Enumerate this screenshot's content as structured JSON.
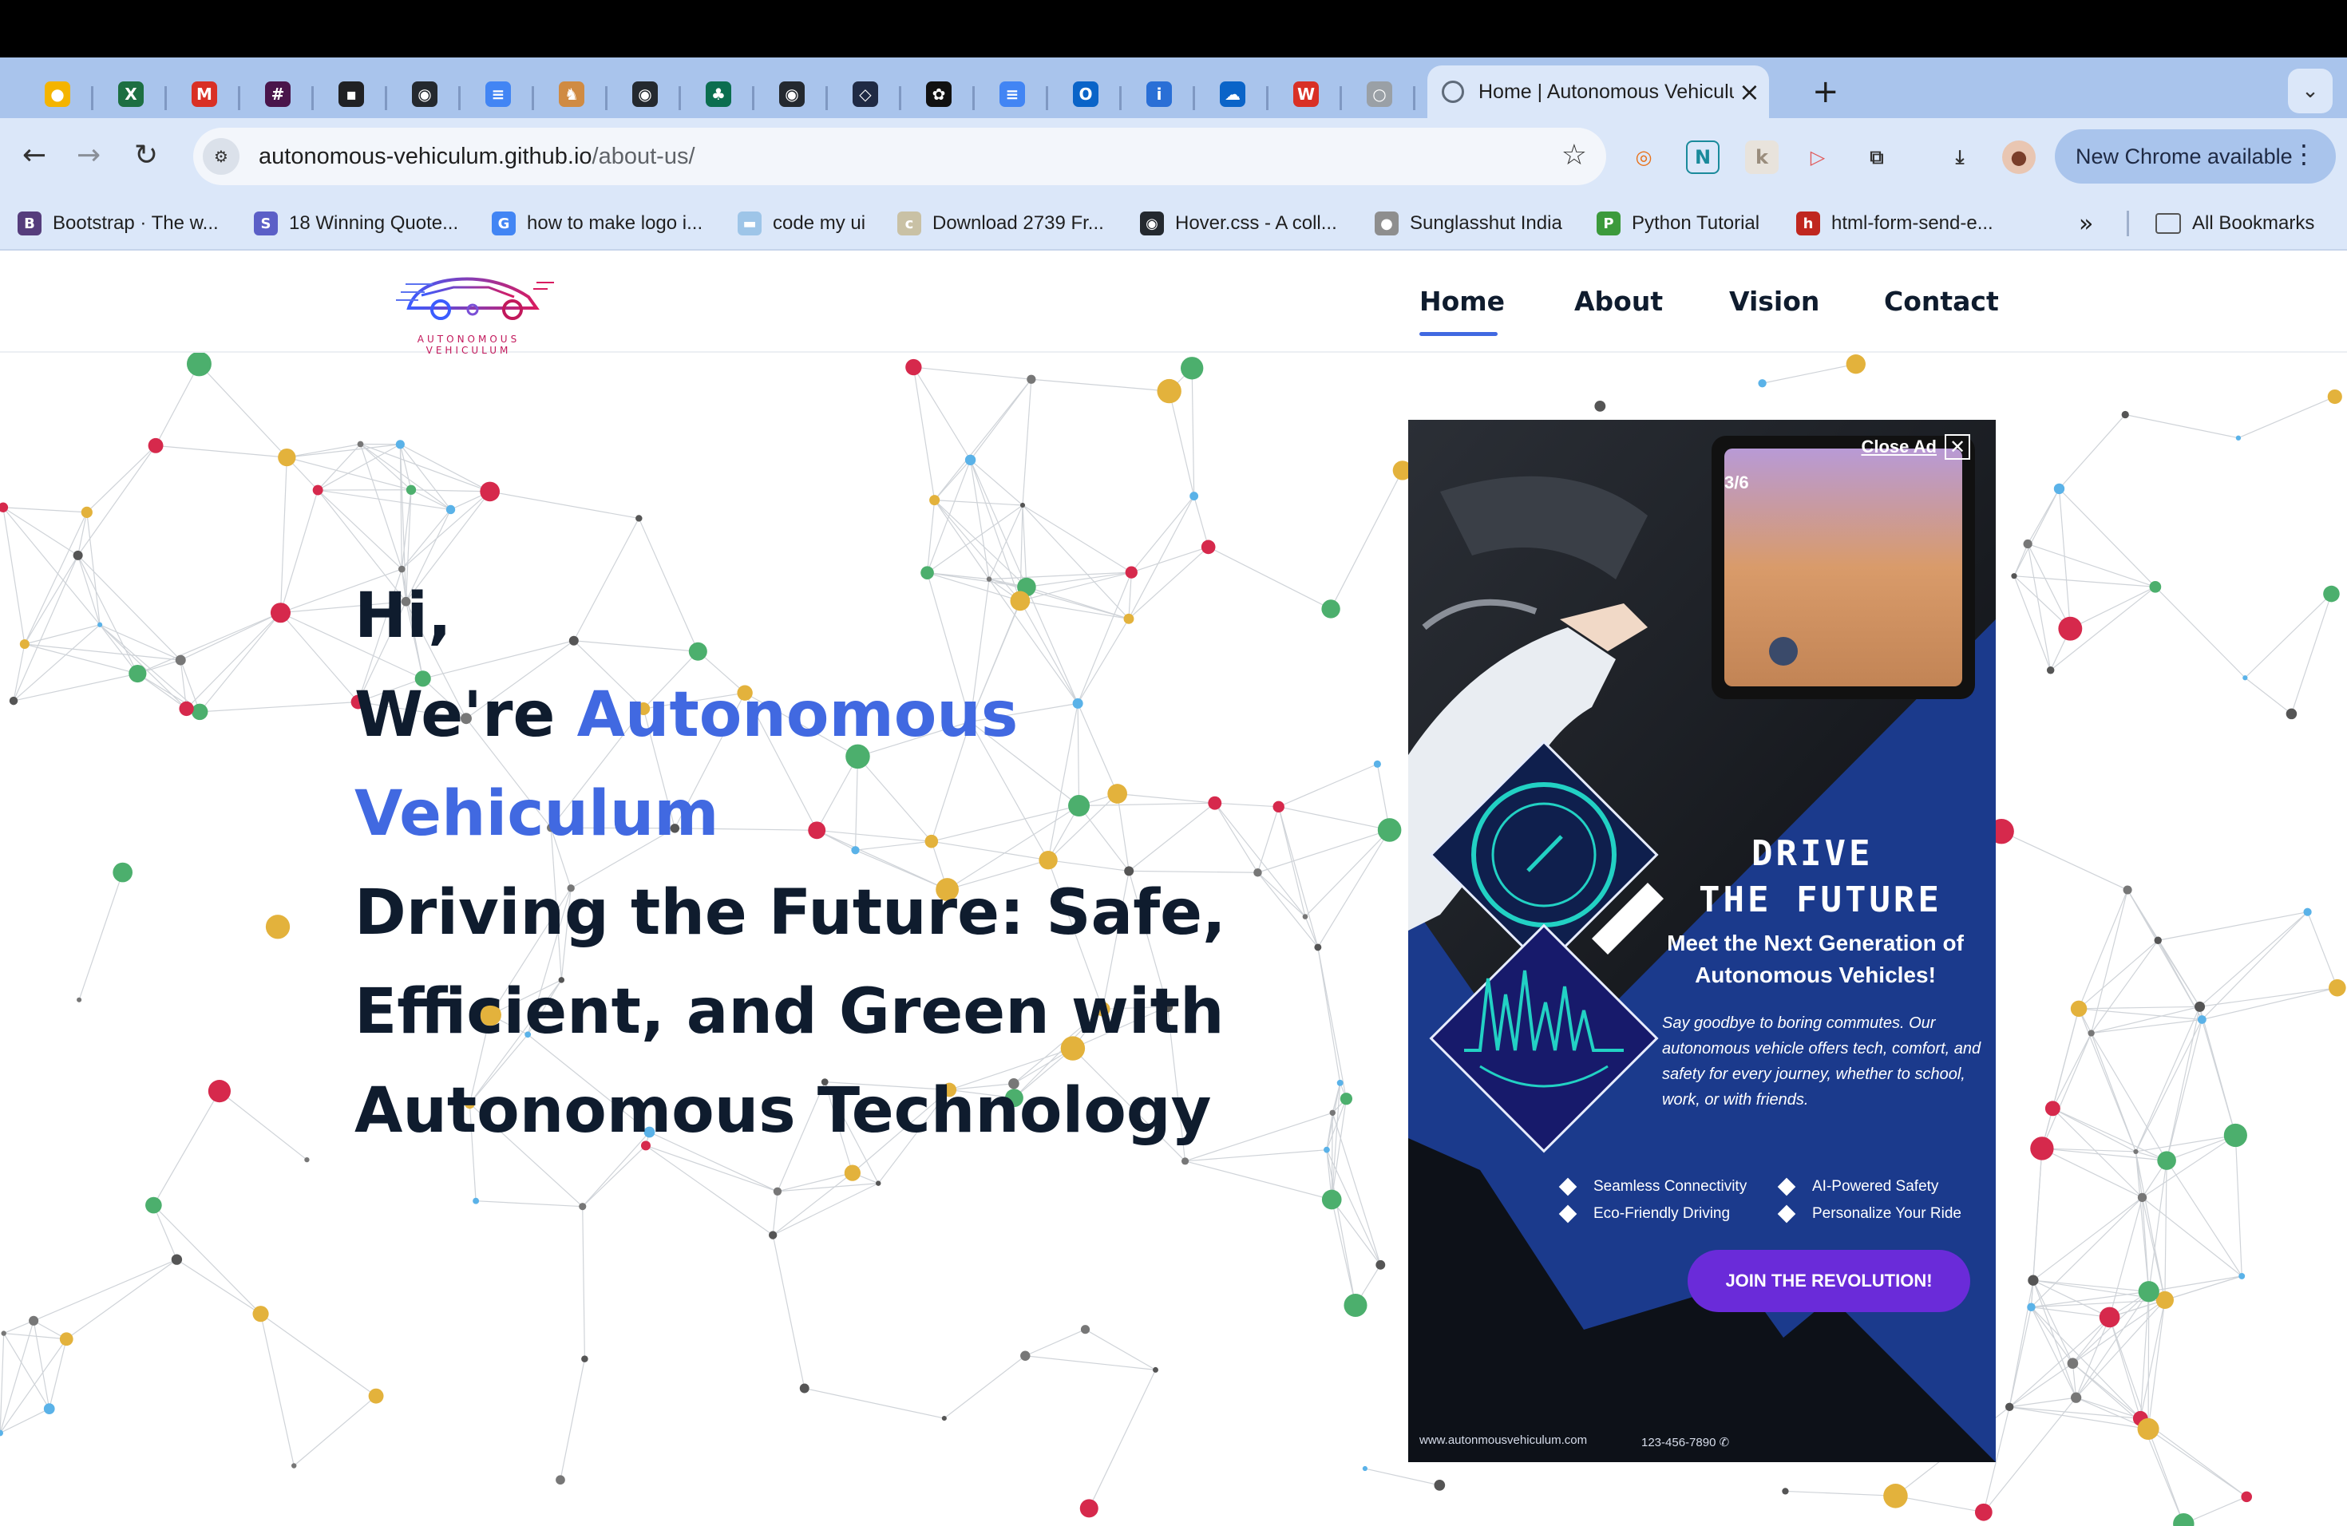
{
  "browser": {
    "tabs": [
      {
        "icon": "keep-icon",
        "color": "#f4b400",
        "glyph": "●"
      },
      {
        "icon": "excel-icon",
        "color": "#1d6f42",
        "glyph": "X"
      },
      {
        "icon": "gmail-icon",
        "color": "#d93025",
        "glyph": "M"
      },
      {
        "icon": "slack-icon",
        "color": "#4a154b",
        "glyph": "#"
      },
      {
        "icon": "app-icon",
        "color": "#202124",
        "glyph": "▪"
      },
      {
        "icon": "github-icon",
        "color": "#24292f",
        "glyph": "◉"
      },
      {
        "icon": "docs-icon",
        "color": "#4285f4",
        "glyph": "≡"
      },
      {
        "icon": "mascot-icon",
        "color": "#d08b43",
        "glyph": "♞"
      },
      {
        "icon": "github-icon",
        "color": "#24292f",
        "glyph": "◉"
      },
      {
        "icon": "leaf-icon",
        "color": "#0b6e4f",
        "glyph": "♣"
      },
      {
        "icon": "github-icon",
        "color": "#24292f",
        "glyph": "◉"
      },
      {
        "icon": "code-icon",
        "color": "#1f2a44",
        "glyph": "◇"
      },
      {
        "icon": "openai-icon",
        "color": "#111111",
        "glyph": "✿"
      },
      {
        "icon": "docs-icon",
        "color": "#4285f4",
        "glyph": "≡"
      },
      {
        "icon": "outlook-icon",
        "color": "#0a64c8",
        "glyph": "O"
      },
      {
        "icon": "info-icon",
        "color": "#2a6fd6",
        "glyph": "i"
      },
      {
        "icon": "onedrive-icon",
        "color": "#0a64c8",
        "glyph": "☁"
      },
      {
        "icon": "brand-icon",
        "color": "#d93025",
        "glyph": "W"
      },
      {
        "icon": "loading-icon",
        "color": "#9aa0a6",
        "glyph": "○"
      }
    ],
    "active_tab_title": "Home | Autonomous Vehiculum",
    "new_tab": "+",
    "tab_search": "⌄",
    "back": "←",
    "forward": "→",
    "reload": "↻",
    "url_host": "autonomous-vehiculum.github.io",
    "url_path": "/about-us/",
    "star": "☆",
    "update_label": "New Chrome available",
    "update_dots": "⋮",
    "bookmarks": [
      {
        "label": "Bootstrap · The w...",
        "icon": "bootstrap-icon",
        "color": "#563d7c",
        "glyph": "B"
      },
      {
        "label": "18 Winning Quote...",
        "icon": "sw-icon",
        "color": "#5b5fc7",
        "glyph": "S"
      },
      {
        "label": "how to make logo i...",
        "icon": "google-icon",
        "color": "#4285f4",
        "glyph": "G"
      },
      {
        "label": "code my ui",
        "icon": "codemyui-icon",
        "color": "#9ec5e8",
        "glyph": "▬"
      },
      {
        "label": "Download 2739 Fr...",
        "icon": "css-icon",
        "color": "#c9c1a5",
        "glyph": "c"
      },
      {
        "label": "Hover.css - A coll...",
        "icon": "github-icon",
        "color": "#24292f",
        "glyph": "◉"
      },
      {
        "label": "Sunglasshut India",
        "icon": "sunglasshut-icon",
        "color": "#8e8e8e",
        "glyph": "●"
      },
      {
        "label": "Python Tutorial",
        "icon": "python-icon",
        "color": "#3c9a3c",
        "glyph": "P"
      },
      {
        "label": "html-form-send-e...",
        "icon": "html-icon",
        "color": "#c0271f",
        "glyph": "h"
      }
    ],
    "bookmarks_more": "»",
    "all_bookmarks": "All Bookmarks"
  },
  "site": {
    "logo_text": "AUTONOMOUS VEHICULUM",
    "nav": [
      "Home",
      "About",
      "Vision",
      "Contact"
    ],
    "active_nav": "Home"
  },
  "hero": {
    "line1": "Hi,",
    "line2_prefix": "We're ",
    "brand_part1": "Autonomous",
    "brand_part2": "Vehiculum",
    "tagline_1": "Driving the Future: Safe,",
    "tagline_2": "Efficient, and Green with",
    "tagline_3": "Autonomous Technology"
  },
  "ad": {
    "close_label": "Close Ad",
    "close_x": "✕",
    "headline_1": "DRIVE",
    "headline_2": "THE FUTURE",
    "subhead": "Meet the Next Generation of Autonomous Vehicles!",
    "body": "Say goodbye to boring commutes. Our autonomous vehicle offers tech, comfort, and safety for every journey, whether to school, work, or with friends.",
    "features": [
      "Seamless Connectivity",
      "AI-Powered Safety",
      "Eco-Friendly Driving",
      "Personalize Your Ride"
    ],
    "cta": "JOIN THE REVOLUTION!",
    "website": "www.autonmousvehiculum.com",
    "phone": "123-456-7890",
    "game_score": "3/6"
  },
  "colors": {
    "accent": "#4169e1",
    "heading": "#0f1c2e",
    "ad_blue": "#1b3a8c",
    "cta_purple": "#6a2bd9",
    "dot_gold": "#e3b23c",
    "dot_blue": "#5ab2e8",
    "dot_red": "#d6294c",
    "dot_green": "#4caf6d"
  }
}
